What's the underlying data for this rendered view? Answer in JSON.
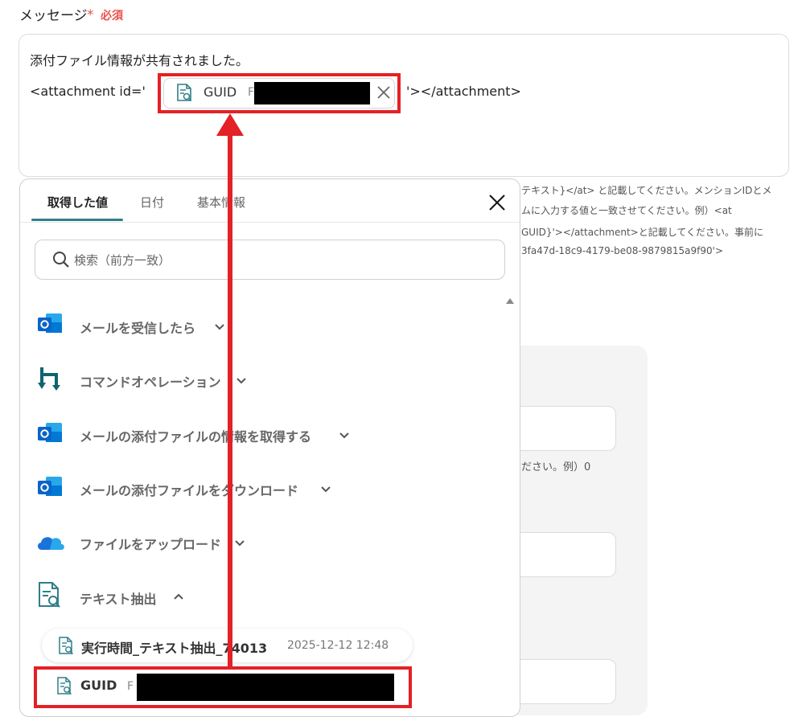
{
  "field": {
    "label": "メッセージ",
    "required_star": "*",
    "required_text": "必須"
  },
  "message": {
    "line1": "添付ファイル情報が共有されました。",
    "prefix": "<attachment id='",
    "suffix": "'></attachment>",
    "chip": {
      "key": "GUID",
      "value_prefix": "F",
      "icon": "text-extract-icon",
      "remove_icon": "close-icon"
    }
  },
  "help_text": {
    "line1": "テキスト}</at> と記載してください。メンションIDとメ",
    "line2": "ムに入力する値と一致させてください。例）<at",
    "line3": "GUID}'></attachment>と記載してください。事前に",
    "line4": "3fa47d-18c9-4179-be08-9879815a9f90'>",
    "line5": "ださい。例）0"
  },
  "popup": {
    "tabs": [
      "取得した値",
      "日付",
      "基本情報"
    ],
    "active_tab": "取得した値",
    "close_icon": "close-icon",
    "search_placeholder": "検索（前方一致）",
    "items": [
      {
        "label": "メールを受信したら",
        "icon": "outlook-icon",
        "expanded": false
      },
      {
        "label": "コマンドオペレーション",
        "icon": "yoom-command-icon",
        "expanded": false
      },
      {
        "label": "メールの添付ファイルの情報を取得する",
        "icon": "outlook-icon",
        "expanded": false
      },
      {
        "label": "メールの添付ファイルをダウンロード",
        "icon": "outlook-icon",
        "expanded": false
      },
      {
        "label": "ファイルをアップロード",
        "icon": "onedrive-icon",
        "expanded": false
      },
      {
        "label": "テキスト抽出",
        "icon": "text-extract-icon",
        "expanded": true
      }
    ],
    "sub_items": [
      {
        "label": "実行時間_テキスト抽出_74013",
        "time": "2025-12-12 12:48"
      },
      {
        "label": "GUID",
        "value_prefix": "F"
      }
    ]
  },
  "colors": {
    "accent": "#2f7f8a",
    "annotation_red": "#e32126",
    "required_red": "#e8524a",
    "outlook_blue": "#0a64c8",
    "onedrive_blue": "#1a73d9"
  }
}
